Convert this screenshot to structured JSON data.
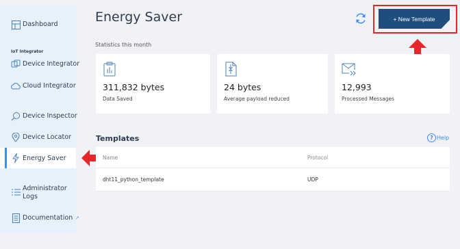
{
  "sidebar": {
    "dashboard": "Dashboard",
    "section_iot": "IoT Integrator",
    "device_integrator": "Device Integrator",
    "cloud_integrator": "Cloud Integrator",
    "device_inspector": "Device Inspector",
    "device_locator": "Device Locator",
    "energy_saver": "Energy Saver",
    "administrator_logs_1": "Administrator",
    "administrator_logs_2": "Logs",
    "documentation": "Documentation",
    "external_glyph": "↗"
  },
  "header": {
    "title": "Energy Saver",
    "new_template_label": "+ New Template"
  },
  "stats": {
    "label": "Statistics this month",
    "cards": [
      {
        "value": "311,832 bytes",
        "caption": "Data Saved"
      },
      {
        "value": "24 bytes",
        "caption": "Average payload reduced"
      },
      {
        "value": "12,993",
        "caption": "Processed Messages"
      }
    ]
  },
  "templates": {
    "title": "Templates",
    "help_label": "Help",
    "help_glyph": "?",
    "columns": [
      "Name",
      "Protocol"
    ],
    "rows": [
      {
        "name": "dht11_python_template",
        "protocol": "UDP"
      }
    ]
  },
  "colors": {
    "accent": "#3d8bf0",
    "button": "#1e4d7e",
    "highlight": "#e8262a",
    "sidebar_bg": "#e6f1fb"
  }
}
